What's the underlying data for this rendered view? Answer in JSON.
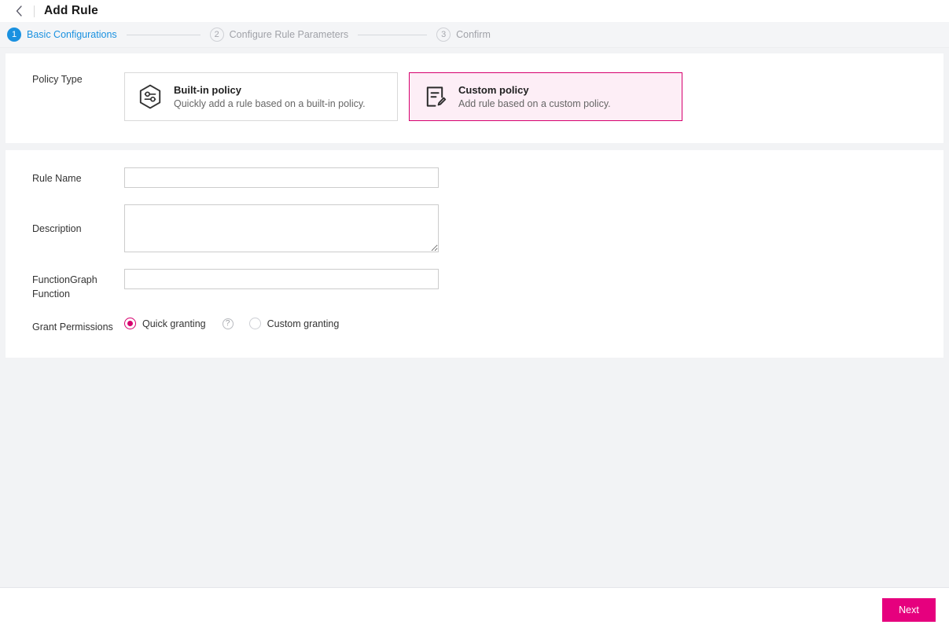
{
  "header": {
    "back_icon": "chevron-left-icon",
    "title": "Add Rule"
  },
  "steps": [
    {
      "num": "1",
      "label": "Basic Configurations",
      "state": "active"
    },
    {
      "num": "2",
      "label": "Configure Rule Parameters",
      "state": "inactive"
    },
    {
      "num": "3",
      "label": "Confirm",
      "state": "inactive"
    }
  ],
  "policy_section": {
    "label": "Policy Type",
    "options": [
      {
        "icon": "hexagon-sliders-icon",
        "title": "Built-in policy",
        "desc": "Quickly add a rule based on a built-in policy.",
        "selected": false
      },
      {
        "icon": "document-pencil-icon",
        "title": "Custom policy",
        "desc": "Add rule based on a custom policy.",
        "selected": true
      }
    ]
  },
  "form": {
    "rule_name": {
      "label": "Rule Name",
      "value": "",
      "placeholder": ""
    },
    "description": {
      "label": "Description",
      "value": "",
      "placeholder": ""
    },
    "function_graph": {
      "label": "FunctionGraph Function",
      "value": "",
      "placeholder": ""
    },
    "grant_permissions": {
      "label": "Grant Permissions",
      "help_icon": "question-circle-icon",
      "options": [
        {
          "label": "Quick granting",
          "checked": true
        },
        {
          "label": "Custom granting",
          "checked": false
        }
      ]
    }
  },
  "footer": {
    "next_label": "Next"
  },
  "colors": {
    "accent_magenta": "#e6007e",
    "selected_border": "#d6006e",
    "selected_bg": "#fdeef6",
    "step_active_blue": "#1a91e0",
    "page_bg": "#f2f3f5"
  }
}
